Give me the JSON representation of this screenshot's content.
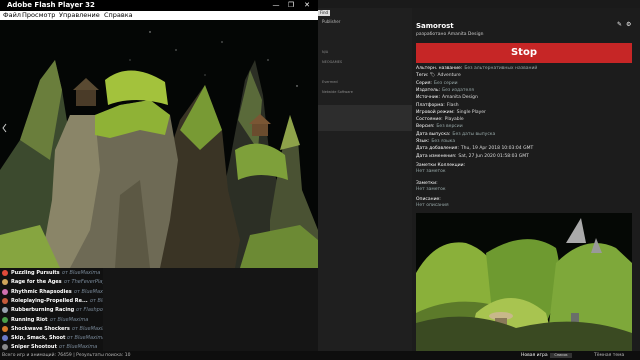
{
  "flash_window": {
    "title": "Adobe Flash Player 32",
    "controls": {
      "minimize": "—",
      "maximize": "❐",
      "close": "✕"
    },
    "menu": [
      "Файл",
      "Просмотр",
      "Управление",
      "Справка"
    ]
  },
  "filter_panel": {
    "search_label": "Find",
    "heading": "Publisher",
    "items": [
      "N/A",
      "NEOGAMES",
      "Evermed",
      "Netwide Software"
    ]
  },
  "game_list": [
    {
      "title": "Puzzling Pursuits",
      "by": "от BlueMaxima",
      "color": "#e24a3a"
    },
    {
      "title": "Rage for the Ages",
      "by": "от TheFeverPlayer",
      "color": "#cfa55a"
    },
    {
      "title": "Rhythmic Rhapsodies",
      "by": "от BlueMaxima",
      "color": "#d070b0"
    },
    {
      "title": "Roleplaying-Propelled Re...",
      "by": "от BlueMaxima",
      "color": "#c45a3a"
    },
    {
      "title": "Rubberburning Racing",
      "by": "от Flashpoint Staff",
      "color": "#9aa3b0"
    },
    {
      "title": "Running Riot",
      "by": "от BlueMaxima",
      "color": "#4aa04a"
    },
    {
      "title": "Shockwave Shockers",
      "by": "от BlueMaxima",
      "color": "#d87a2a"
    },
    {
      "title": "Skip, Smack, Shoot",
      "by": "от BlueMaxima",
      "color": "#6a7ac8"
    },
    {
      "title": "Sniper Shootout",
      "by": "от BlueMaxima",
      "color": "#8a8a8a"
    }
  ],
  "details": {
    "title": "Samorost",
    "developer": "разработано Amanita Design",
    "stop_label": "Stop",
    "fields": [
      {
        "key": "Альтерн. название:",
        "value": "Без альтернативных названий",
        "dim": true
      },
      {
        "key": "Теги:",
        "value": "Adventure",
        "dim": false,
        "tag": true
      },
      {
        "key": "Серия:",
        "value": "Без серии",
        "dim": true
      },
      {
        "key": "Издатель:",
        "value": "Без издателя",
        "dim": true
      },
      {
        "key": "Источник:",
        "value": "Amanita Design",
        "dim": false
      },
      {
        "key": "Платформа:",
        "value": "Flash",
        "dim": false
      },
      {
        "key": "Игровой режим:",
        "value": "Single Player",
        "dim": false
      },
      {
        "key": "Состояние:",
        "value": "Playable",
        "dim": false
      },
      {
        "key": "Версия:",
        "value": "Без версии",
        "dim": true
      },
      {
        "key": "Дата выпуска:",
        "value": "Без даты выпуска",
        "dim": true
      },
      {
        "key": "Язык:",
        "value": "Без языка",
        "dim": true
      },
      {
        "key": "Дата добавления:",
        "value": "Thu, 19 Apr 2018 10:03:04 GMT",
        "dim": false
      },
      {
        "key": "Дата изменения:",
        "value": "Sat, 27 Jun 2020 01:58:03 GMT",
        "dim": false
      }
    ],
    "notes_collection_label": "Заметки Коллекции:",
    "notes_collection_value": "Нет заметок",
    "notes_label": "Заметки:",
    "notes_value": "Нет заметок",
    "description_label": "Описание:",
    "description_value": "Нет описания"
  },
  "statusbar": {
    "total": "Всего игр и анимаций: 76459 | Результаты поиска: 10",
    "new_game": "Новая игра",
    "new_btn": "Список",
    "version": "Тёмная тема"
  },
  "colors": {
    "stop": "#c62626",
    "panel": "#1c1c1c",
    "moss": "#7c9a2c"
  }
}
